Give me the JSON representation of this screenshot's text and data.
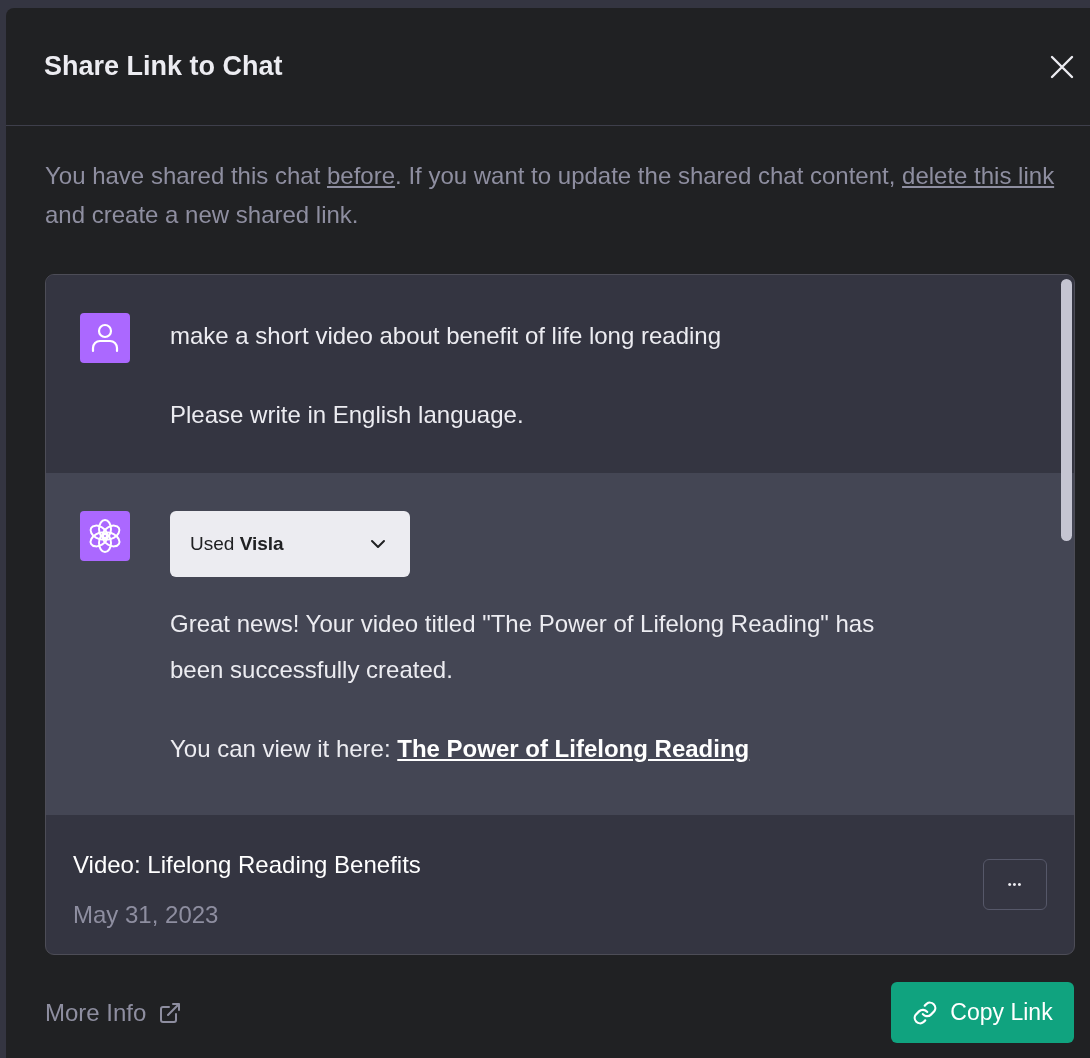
{
  "dialog": {
    "title": "Share Link to Chat",
    "notice": [
      {
        "text": "You have shared this chat ",
        "link": false
      },
      {
        "text": "before",
        "link": true
      },
      {
        "text": ". If you want to update the shared chat content, ",
        "link": false
      },
      {
        "text": "delete this link",
        "link": true
      },
      {
        "text": " and create a new shared link.",
        "link": false
      }
    ],
    "messages": [
      {
        "kind": "user",
        "paragraphs": [
          [
            {
              "text": "make a short video about benefit of life long reading",
              "link": false
            }
          ],
          [
            {
              "text": "Please write in English language.",
              "link": false
            }
          ]
        ]
      },
      {
        "kind": "assistant",
        "tool": {
          "prefix": "Used",
          "name": "Visla",
          "expanded": false
        },
        "paragraphs": [
          [
            {
              "text": "Great news! Your video titled \"The Power of Lifelong Reading\" has been successfully created.",
              "link": false
            }
          ],
          [
            {
              "text": "You can view it here: ",
              "link": false
            },
            {
              "text": "The Power of Lifelong Reading",
              "link": true
            }
          ]
        ]
      }
    ],
    "chat_title": "Video: Lifelong Reading Benefits",
    "chat_date": "May 31, 2023",
    "more_button": "•••",
    "more_info": "More Info",
    "copy_button": "Copy Link"
  }
}
